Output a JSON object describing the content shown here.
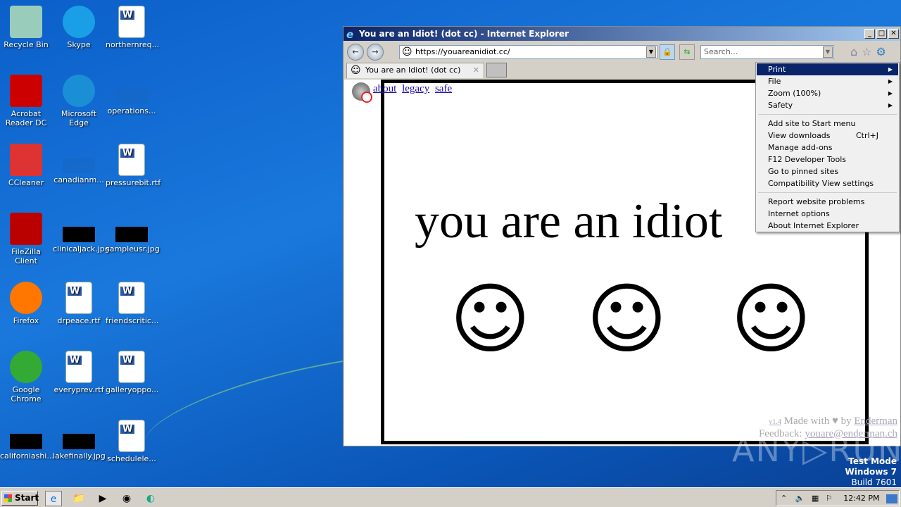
{
  "desktop": {
    "icons": [
      {
        "label": "Recycle Bin",
        "icon": "recycle-bin-icon"
      },
      {
        "label": "Skype",
        "icon": "skype-icon"
      },
      {
        "label": "northernreq...",
        "icon": "word-doc-icon"
      },
      {
        "label": "Acrobat Reader DC",
        "icon": "acrobat-icon"
      },
      {
        "label": "Microsoft Edge",
        "icon": "edge-icon"
      },
      {
        "label": "operations...",
        "icon": "file-icon"
      },
      {
        "label": "CCleaner",
        "icon": "ccleaner-icon"
      },
      {
        "label": "canadianm...",
        "icon": "file-icon"
      },
      {
        "label": "pressurebit.rtf",
        "icon": "word-doc-icon"
      },
      {
        "label": "FileZilla Client",
        "icon": "filezilla-icon"
      },
      {
        "label": "clinicaljack.jpg",
        "icon": "image-icon"
      },
      {
        "label": "sampleusr.jpg",
        "icon": "image-icon"
      },
      {
        "label": "Firefox",
        "icon": "firefox-icon"
      },
      {
        "label": "drpeace.rtf",
        "icon": "word-doc-icon"
      },
      {
        "label": "friendscritic...",
        "icon": "word-doc-icon"
      },
      {
        "label": "Google Chrome",
        "icon": "chrome-icon"
      },
      {
        "label": "everyprev.rtf",
        "icon": "word-doc-icon"
      },
      {
        "label": "galleryoppo...",
        "icon": "word-doc-icon"
      },
      {
        "label": "californiashi...",
        "icon": "image-icon"
      },
      {
        "label": "lakefinally.jpg",
        "icon": "image-icon"
      },
      {
        "label": "schedulele...",
        "icon": "word-doc-icon"
      }
    ]
  },
  "browser": {
    "title": "You are an Idiot! (dot cc) - Internet Explorer",
    "url": "https://youareanidiot.cc/",
    "search_placeholder": "Search...",
    "tab_label": "You are an Idiot! (dot cc)",
    "page": {
      "links": [
        "about",
        "legacy",
        "safe"
      ],
      "headline": "you are an idiot",
      "face": "☺",
      "version": "v1.4",
      "made_with": "Made with",
      "by": "by",
      "author": "Enderman",
      "feedback": "Feedback:",
      "email": "youare@enderman.ch"
    }
  },
  "menu": {
    "items": [
      {
        "label": "Print",
        "submenu": true,
        "selected": true
      },
      {
        "label": "File",
        "submenu": true
      },
      {
        "label": "Zoom (100%)",
        "submenu": true
      },
      {
        "label": "Safety",
        "submenu": true
      },
      {
        "sep": true
      },
      {
        "label": "Add site to Start menu"
      },
      {
        "label": "View downloads",
        "shortcut": "Ctrl+J"
      },
      {
        "label": "Manage add-ons"
      },
      {
        "label": "F12 Developer Tools"
      },
      {
        "label": "Go to pinned sites"
      },
      {
        "label": "Compatibility View settings"
      },
      {
        "sep": true
      },
      {
        "label": "Report website problems"
      },
      {
        "label": "Internet options"
      },
      {
        "label": "About Internet Explorer"
      }
    ]
  },
  "watermark": {
    "line1": "Test Mode",
    "line2": "Windows 7",
    "line3": "Build 7601",
    "brand": "ANY▷RUN"
  },
  "taskbar": {
    "start": "Start",
    "clock": "12:42 PM"
  }
}
